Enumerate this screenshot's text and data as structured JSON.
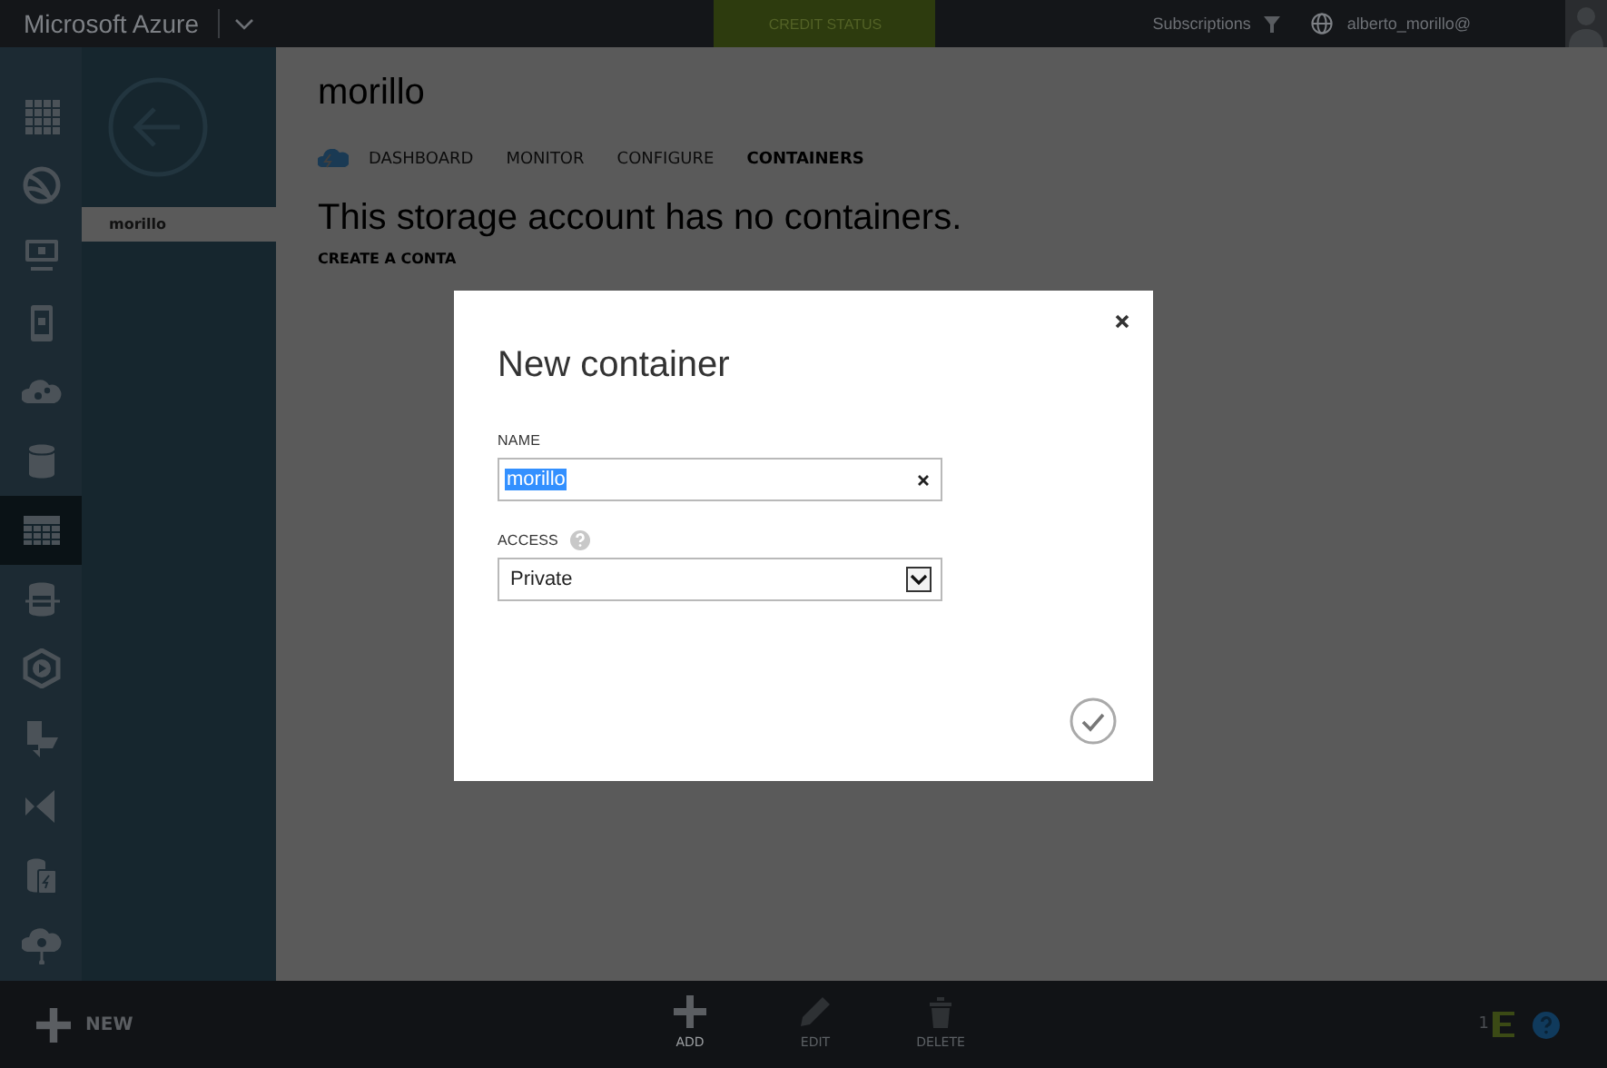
{
  "top_bar": {
    "brand": "Microsoft Azure",
    "credit_status": "CREDIT STATUS",
    "subscriptions": "Subscriptions",
    "user": "alberto_morillo@"
  },
  "nav": [
    {
      "selected": false
    },
    {
      "selected": false
    },
    {
      "selected": false
    },
    {
      "selected": false
    },
    {
      "selected": false
    },
    {
      "selected": false
    },
    {
      "selected": true
    },
    {
      "selected": false
    },
    {
      "selected": false
    },
    {
      "selected": false
    },
    {
      "selected": false
    },
    {
      "selected": false
    },
    {
      "selected": false
    }
  ],
  "resource_list": [
    {
      "label": "morillo",
      "selected": true
    }
  ],
  "page": {
    "title": "morillo",
    "tabs": [
      {
        "label": "DASHBOARD",
        "selected": false
      },
      {
        "label": "MONITOR",
        "selected": false
      },
      {
        "label": "CONFIGURE",
        "selected": false
      },
      {
        "label": "CONTAINERS",
        "selected": true
      }
    ],
    "empty_message": "This storage account has no containers.",
    "create_link": "CREATE A CONTA"
  },
  "command_bar": {
    "new": "NEW",
    "actions": [
      {
        "label": "ADD",
        "disabled": false
      },
      {
        "label": "EDIT",
        "disabled": true
      },
      {
        "label": "DELETE",
        "disabled": true
      }
    ],
    "notification_count": "1"
  },
  "dialog": {
    "title": "New container",
    "fields": [
      {
        "kind": "text",
        "label": "NAME",
        "value": "morillo",
        "text_selected": true,
        "help": false
      },
      {
        "kind": "select",
        "label": "ACCESS",
        "value": "Private",
        "help": true
      }
    ]
  }
}
